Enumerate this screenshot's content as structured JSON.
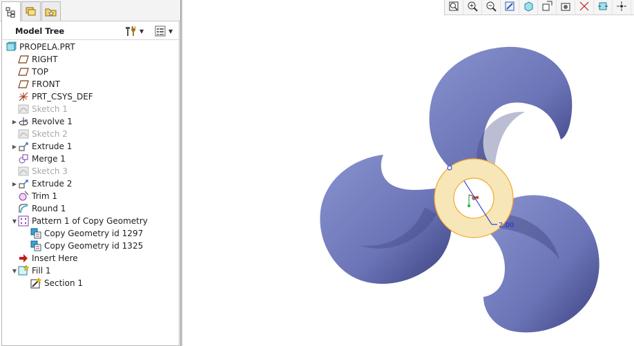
{
  "tree": {
    "title": "Model Tree",
    "items": [
      {
        "label": "PROPELA.PRT",
        "icon": "part-icon",
        "indent": 0,
        "expander": "",
        "dim": false
      },
      {
        "label": "RIGHT",
        "icon": "datum-plane-icon",
        "indent": 1,
        "expander": "",
        "dim": false
      },
      {
        "label": "TOP",
        "icon": "datum-plane-icon",
        "indent": 1,
        "expander": "",
        "dim": false
      },
      {
        "label": "FRONT",
        "icon": "datum-plane-icon",
        "indent": 1,
        "expander": "",
        "dim": false
      },
      {
        "label": "PRT_CSYS_DEF",
        "icon": "csys-icon",
        "indent": 1,
        "expander": "",
        "dim": false
      },
      {
        "label": "Sketch 1",
        "icon": "sketch-icon",
        "indent": 1,
        "expander": "",
        "dim": true
      },
      {
        "label": "Revolve 1",
        "icon": "revolve-icon",
        "indent": 1,
        "expander": "collapsed",
        "dim": false
      },
      {
        "label": "Sketch 2",
        "icon": "sketch-icon",
        "indent": 1,
        "expander": "",
        "dim": true
      },
      {
        "label": "Extrude 1",
        "icon": "extrude-icon",
        "indent": 1,
        "expander": "collapsed",
        "dim": false
      },
      {
        "label": "Merge 1",
        "icon": "merge-icon",
        "indent": 1,
        "expander": "",
        "dim": false
      },
      {
        "label": "Sketch 3",
        "icon": "sketch-icon",
        "indent": 1,
        "expander": "",
        "dim": true
      },
      {
        "label": "Extrude 2",
        "icon": "extrude-icon",
        "indent": 1,
        "expander": "collapsed",
        "dim": false
      },
      {
        "label": "Trim 1",
        "icon": "trim-icon",
        "indent": 1,
        "expander": "",
        "dim": false
      },
      {
        "label": "Round 1",
        "icon": "round-icon",
        "indent": 1,
        "expander": "",
        "dim": false
      },
      {
        "label": "Pattern 1 of Copy Geometry",
        "icon": "pattern-icon",
        "indent": 1,
        "expander": "expanded",
        "dim": false
      },
      {
        "label": "Copy Geometry id 1297",
        "icon": "copy-geometry-icon",
        "indent": 2,
        "expander": "",
        "dim": false
      },
      {
        "label": "Copy Geometry id 1325",
        "icon": "copy-geometry-icon",
        "indent": 2,
        "expander": "",
        "dim": false
      },
      {
        "label": "Insert Here",
        "icon": "insert-here-arrow-icon",
        "indent": 1,
        "expander": "",
        "dim": false
      },
      {
        "label": "Fill 1",
        "icon": "fill-icon",
        "indent": 1,
        "expander": "expanded",
        "dim": false
      },
      {
        "label": "Section 1",
        "icon": "section-icon",
        "indent": 2,
        "expander": "",
        "dim": false
      }
    ]
  },
  "viewport": {
    "dimension_text": "2.00"
  },
  "toolbar": {
    "buttons": [
      "refit-icon",
      "zoom-in-icon",
      "zoom-out-icon",
      "repaint-icon",
      "display-style-icon",
      "saved-orientations-icon",
      "view-manager-icon",
      "datum-display-icon",
      "annotation-display-icon",
      "spin-center-icon"
    ]
  },
  "colors": {
    "blade": "#7a84c4",
    "hub_fill": "#f7e6b8",
    "hub_edge": "#f5a623",
    "dimension": "#1b2bd6"
  }
}
